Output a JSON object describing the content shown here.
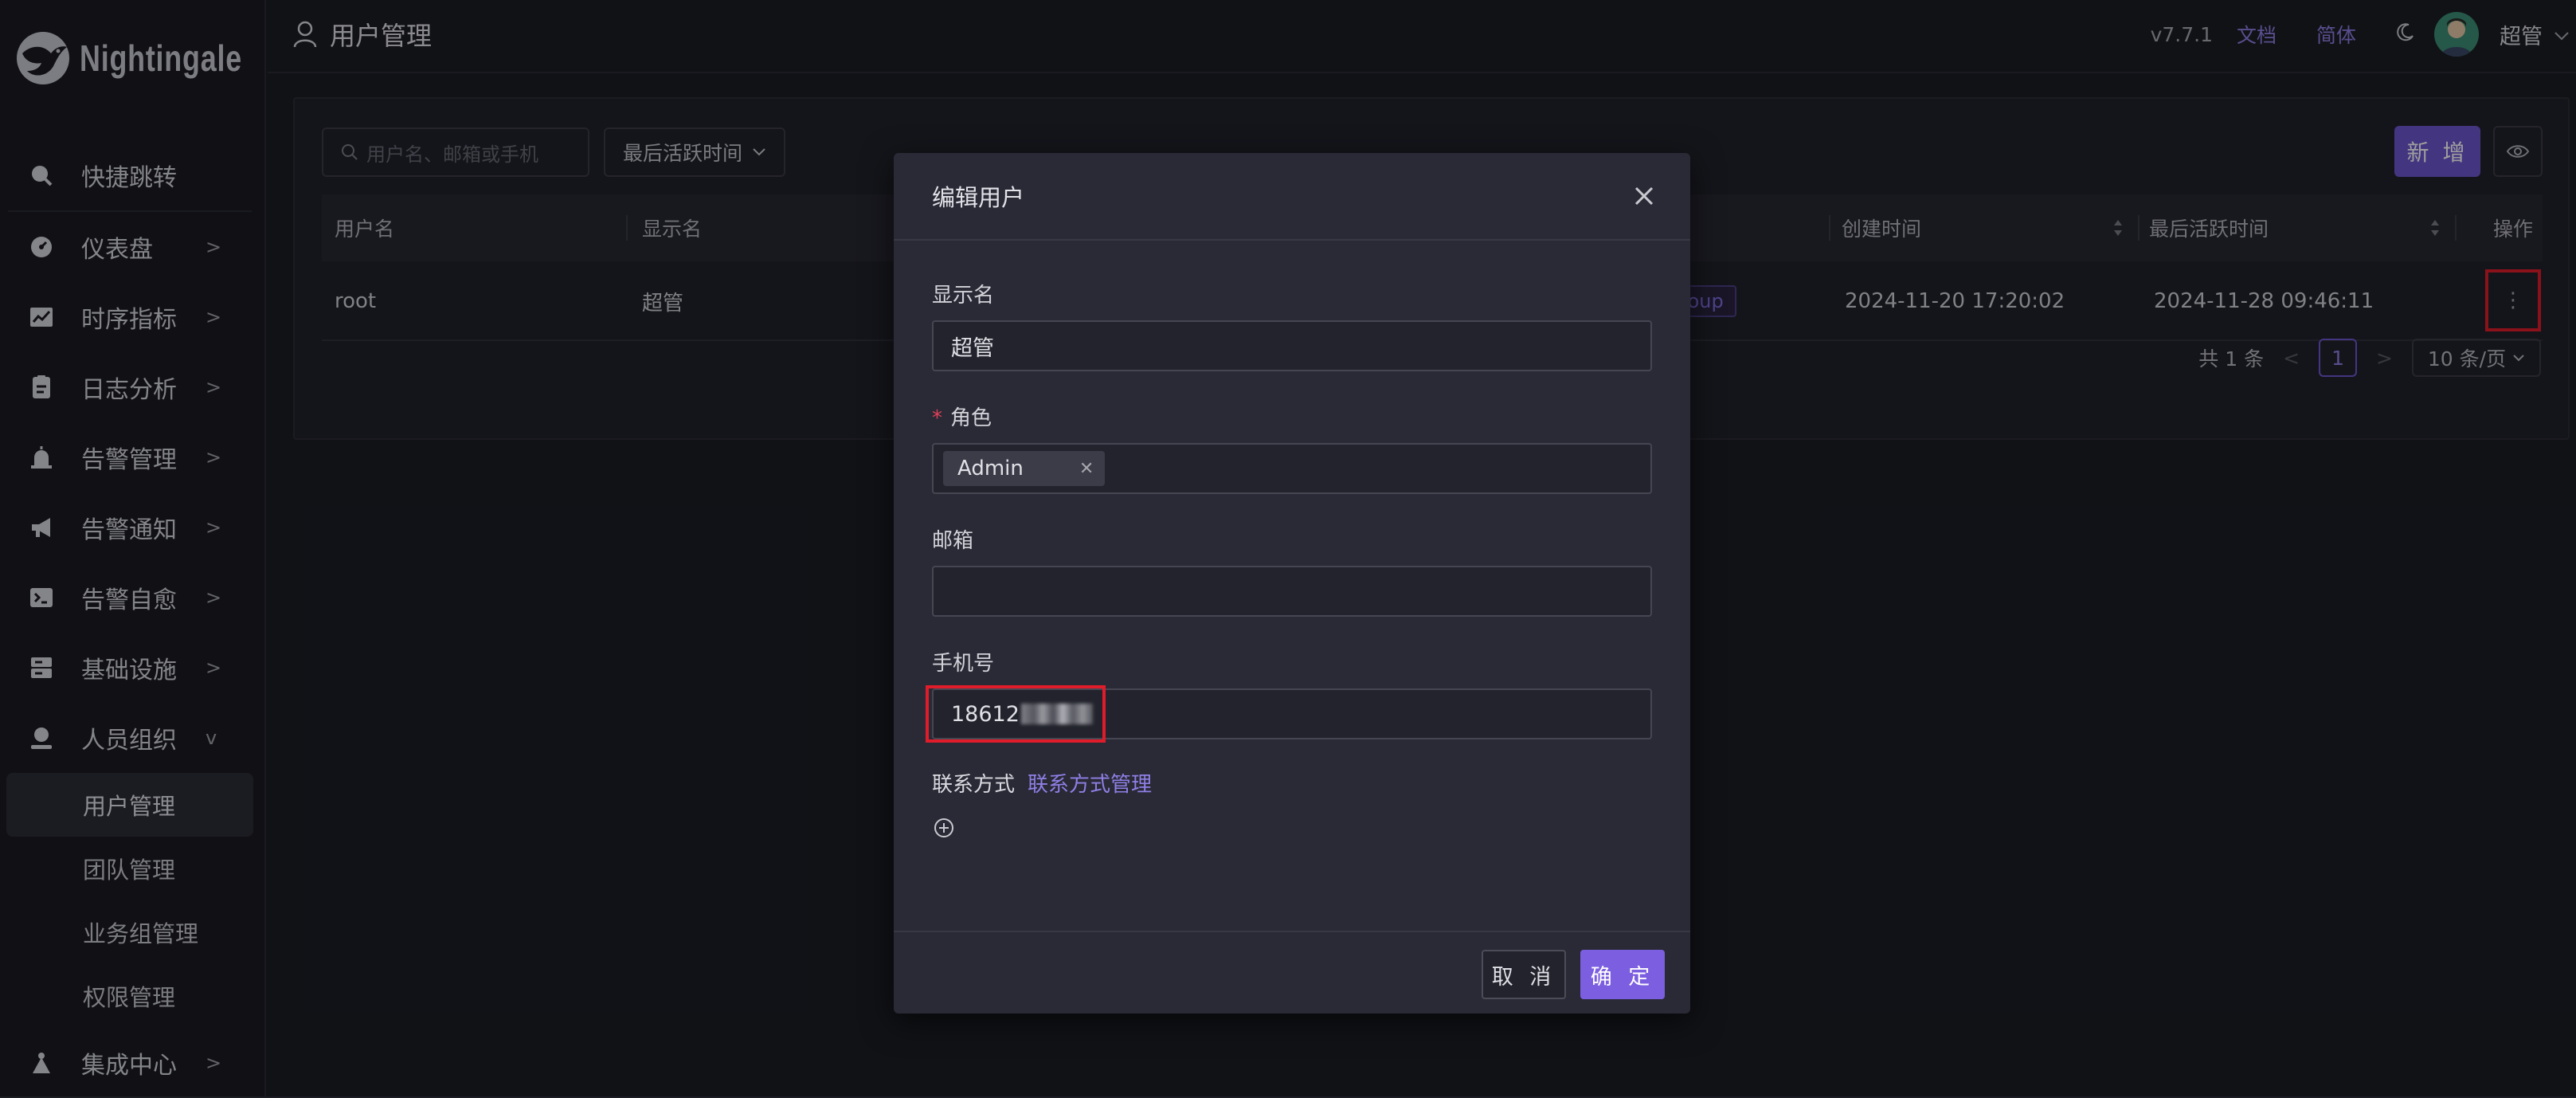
{
  "app": {
    "name": "Nightingale"
  },
  "header": {
    "page_title": "用户管理",
    "version": "v7.7.1",
    "docs_link": "文档",
    "lang_link": "简体",
    "user_name": "超管"
  },
  "sidebar": {
    "quick_jump": "快捷跳转",
    "items": [
      {
        "label": "仪表盘",
        "icon": "dashboard-icon"
      },
      {
        "label": "时序指标",
        "icon": "chart-icon"
      },
      {
        "label": "日志分析",
        "icon": "log-icon"
      },
      {
        "label": "告警管理",
        "icon": "alarm-icon"
      },
      {
        "label": "告警通知",
        "icon": "megaphone-icon"
      },
      {
        "label": "告警自愈",
        "icon": "terminal-icon"
      },
      {
        "label": "基础设施",
        "icon": "server-icon"
      },
      {
        "label": "人员组织",
        "icon": "user-icon"
      }
    ],
    "sub_items": [
      "用户管理",
      "团队管理",
      "业务组管理",
      "权限管理"
    ],
    "last_item": {
      "label": "集成中心",
      "icon": "integration-icon"
    }
  },
  "toolbar": {
    "search_placeholder": "用户名、邮箱或手机",
    "filter_label": "最后活跃时间",
    "add_label": "新 增"
  },
  "table": {
    "columns": [
      "用户名",
      "显示名",
      "创建时间",
      "最后活跃时间",
      "操作"
    ],
    "rows": [
      {
        "username": "root",
        "nickname": "超管",
        "tag": "group",
        "created": "2024-11-20 17:20:02",
        "last_active": "2024-11-28 09:46:11",
        "action": "⋮"
      }
    ]
  },
  "pagination": {
    "total": "共 1 条",
    "current": "1",
    "page_size": "10 条/页"
  },
  "modal": {
    "title": "编辑用户",
    "fields": {
      "nickname_label": "显示名",
      "nickname_value": "超管",
      "roles_label": "角色",
      "role_chip": "Admin",
      "email_label": "邮箱",
      "email_value": "",
      "phone_label": "手机号",
      "phone_value": "18612",
      "contact_label": "联系方式",
      "contact_manage": "联系方式管理"
    },
    "cancel_label": "取 消",
    "ok_label": "确 定"
  },
  "colors": {
    "accent": "#6e56cf",
    "highlight": "#e01c2b",
    "background": "#1c1d25"
  }
}
